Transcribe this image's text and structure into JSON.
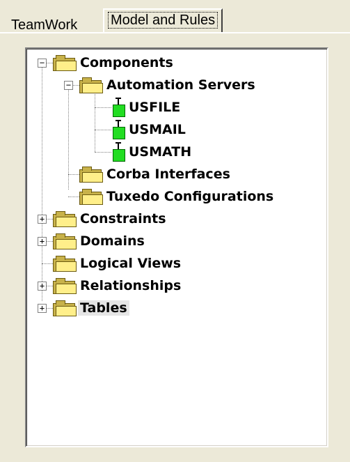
{
  "tabs": [
    {
      "label": "TeamWork",
      "active": false
    },
    {
      "label": "Model and Rules",
      "active": true
    }
  ],
  "tree": {
    "components": "Components",
    "automation_servers": "Automation Servers",
    "usfile": "USFILE",
    "usmail": "USMAIL",
    "usmath": "USMATH",
    "corba_interfaces": "Corba Interfaces",
    "tuxedo_configurations": "Tuxedo Configurations",
    "constraints": "Constraints",
    "domains": "Domains",
    "logical_views": "Logical Views",
    "relationships": "Relationships",
    "tables": "Tables"
  },
  "selected_node": "Tables",
  "icons": {
    "folder": "folder-icon",
    "server": "automation-server-icon"
  },
  "colors": {
    "background": "#ece9d8",
    "folder": "#ffef8a",
    "server": "#22dd22"
  }
}
